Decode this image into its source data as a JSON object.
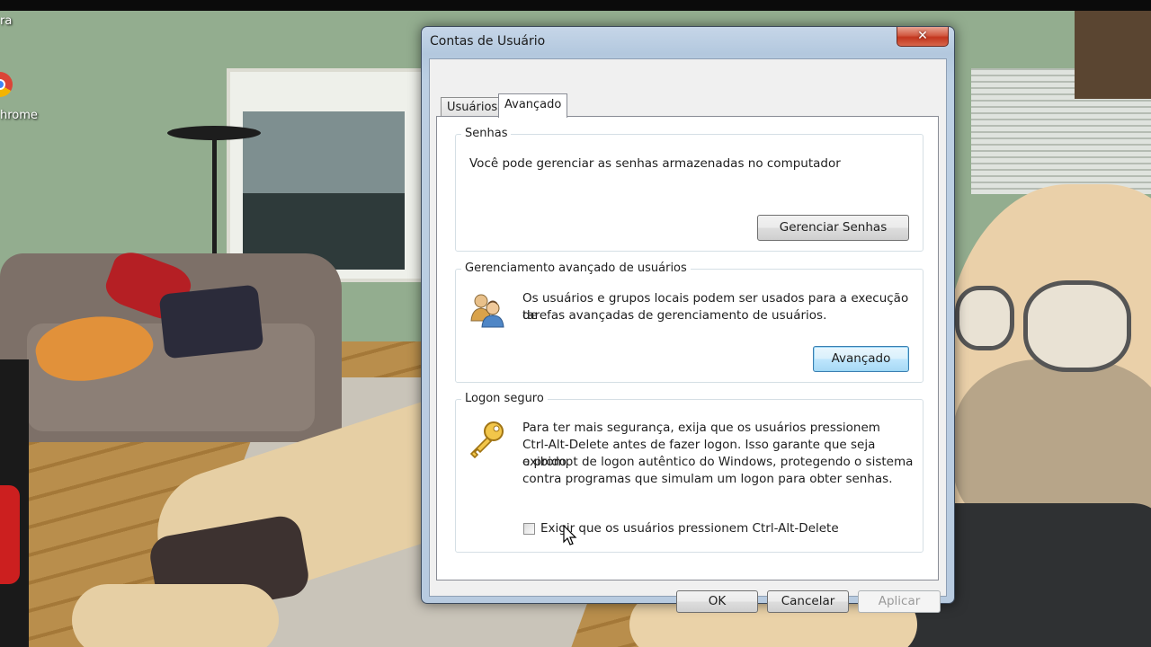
{
  "desktop": {
    "icon_top_label": "ra",
    "chrome_label": "hrome"
  },
  "dialog": {
    "title": "Contas de Usuário",
    "close_glyph": "✕",
    "tabs": [
      {
        "label": "Usuários",
        "active": false
      },
      {
        "label": "Avançado",
        "active": true
      }
    ],
    "passwords": {
      "title": "Senhas",
      "description": "Você pode gerenciar as senhas armazenadas no computador",
      "button": "Gerenciar Senhas"
    },
    "advanced_users": {
      "title": "Gerenciamento avançado de usuários",
      "icon": "users-icon",
      "line1": "Os usuários e grupos locais podem ser usados para a execução de",
      "line2": "tarefas avançadas de gerenciamento de usuários.",
      "button": "Avançado"
    },
    "secure_logon": {
      "title": "Logon seguro",
      "icon": "key-icon",
      "line1": "Para ter mais segurança, exija que os usuários pressionem",
      "line2": "Ctrl-Alt-Delete antes de fazer logon. Isso garante que seja exibido",
      "line3": "o prompt de logon autêntico do Windows, protegendo o sistema",
      "line4": "contra programas que simulam um logon para obter senhas.",
      "checkbox_label": "Exigir que os usuários pressionem Ctrl-Alt-Delete",
      "checkbox_checked": false
    },
    "footer": {
      "ok": "OK",
      "cancel": "Cancelar",
      "apply": "Aplicar",
      "apply_enabled": false
    }
  }
}
